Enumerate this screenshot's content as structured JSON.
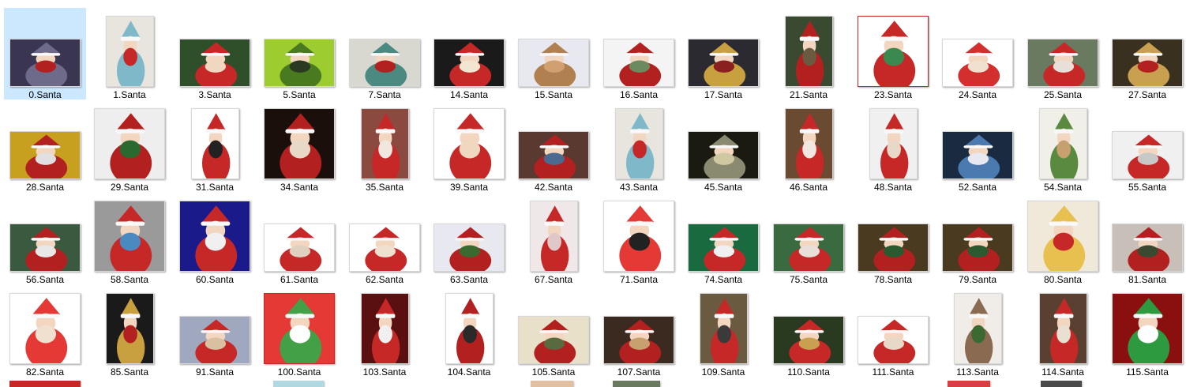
{
  "files": [
    {
      "label": "0.Santa",
      "orient": "landscape",
      "colors": [
        "#3a3550",
        "#6e6a8a",
        "#b22020"
      ],
      "selected": true
    },
    {
      "label": "1.Santa",
      "orient": "portrait",
      "colors": [
        "#e8e4de",
        "#7fb8c8",
        "#c62828"
      ]
    },
    {
      "label": "3.Santa",
      "orient": "landscape",
      "colors": [
        "#2f4f2a",
        "#c62828",
        "#f0d8c0"
      ]
    },
    {
      "label": "5.Santa",
      "orient": "landscape",
      "colors": [
        "#9ccc30",
        "#4a7a20",
        "#2a3a20"
      ]
    },
    {
      "label": "7.Santa",
      "orient": "landscape",
      "colors": [
        "#d8d8d0",
        "#4a8a80",
        "#b22020"
      ]
    },
    {
      "label": "14.Santa",
      "orient": "landscape",
      "colors": [
        "#1a1a1a",
        "#c62828",
        "#f2e6d0"
      ]
    },
    {
      "label": "15.Santa",
      "orient": "landscape",
      "colors": [
        "#e8e8f0",
        "#b08050",
        "#d0a070"
      ]
    },
    {
      "label": "16.Santa",
      "orient": "landscape",
      "colors": [
        "#f4f4f4",
        "#b22020",
        "#6a8a60"
      ]
    },
    {
      "label": "17.Santa",
      "orient": "landscape",
      "colors": [
        "#2a2a30",
        "#c8a040",
        "#8a2020"
      ]
    },
    {
      "label": "21.Santa",
      "orient": "portrait",
      "colors": [
        "#3a4a30",
        "#b22020",
        "#6a5a40"
      ]
    },
    {
      "label": "23.Santa",
      "orient": "square",
      "colors": [
        "#ffffff",
        "#c62828",
        "#3a8a50"
      ],
      "border": "#c62828"
    },
    {
      "label": "24.Santa",
      "orient": "landscape",
      "colors": [
        "#ffffff",
        "#d32f2f",
        "#f0e0d0"
      ]
    },
    {
      "label": "25.Santa",
      "orient": "landscape",
      "colors": [
        "#6a7a60",
        "#c62828",
        "#e8e0d8"
      ]
    },
    {
      "label": "27.Santa",
      "orient": "landscape",
      "colors": [
        "#3a3020",
        "#c8a050",
        "#b22020"
      ]
    },
    {
      "label": "28.Santa",
      "orient": "landscape",
      "colors": [
        "#c8a020",
        "#b22020",
        "#e0e0e0"
      ]
    },
    {
      "label": "29.Santa",
      "orient": "square",
      "colors": [
        "#eeeeee",
        "#b22020",
        "#2a6a30"
      ]
    },
    {
      "label": "31.Santa",
      "orient": "portrait",
      "colors": [
        "#ffffff",
        "#c62828",
        "#222222"
      ]
    },
    {
      "label": "34.Santa",
      "orient": "square",
      "colors": [
        "#1a0f0a",
        "#b22020",
        "#e8d8c8"
      ]
    },
    {
      "label": "35.Santa",
      "orient": "portrait",
      "colors": [
        "#8a4a40",
        "#c62828",
        "#f0e8e0"
      ]
    },
    {
      "label": "39.Santa",
      "orient": "square",
      "colors": [
        "#ffffff",
        "#c62828",
        "#f0d8c0"
      ]
    },
    {
      "label": "42.Santa",
      "orient": "landscape",
      "colors": [
        "#5a3a30",
        "#b22020",
        "#4a6a90"
      ]
    },
    {
      "label": "43.Santa",
      "orient": "portrait",
      "colors": [
        "#e8e4de",
        "#7fb8c8",
        "#c62828"
      ]
    },
    {
      "label": "45.Santa",
      "orient": "landscape",
      "colors": [
        "#1a1a10",
        "#8a8a70",
        "#d0c8a0"
      ]
    },
    {
      "label": "46.Santa",
      "orient": "portrait",
      "colors": [
        "#6a4a30",
        "#c62828",
        "#f0e8e0"
      ]
    },
    {
      "label": "48.Santa",
      "orient": "portrait",
      "colors": [
        "#f0f0f0",
        "#c62828",
        "#e8d8c8"
      ]
    },
    {
      "label": "52.Santa",
      "orient": "landscape",
      "colors": [
        "#1a2a40",
        "#4a7ab0",
        "#e8e8f0"
      ]
    },
    {
      "label": "54.Santa",
      "orient": "portrait",
      "colors": [
        "#f0f0e8",
        "#5a8a40",
        "#c8a070"
      ]
    },
    {
      "label": "55.Santa",
      "orient": "landscape",
      "colors": [
        "#f0f0f0",
        "#c62828",
        "#c8c8c8"
      ]
    },
    {
      "label": "56.Santa",
      "orient": "landscape",
      "colors": [
        "#3a5a40",
        "#b22020",
        "#e8e8e8"
      ]
    },
    {
      "label": "58.Santa",
      "orient": "square",
      "colors": [
        "#9a9a9a",
        "#c62828",
        "#4a8ac0"
      ]
    },
    {
      "label": "60.Santa",
      "orient": "square",
      "colors": [
        "#1a1a8a",
        "#c62828",
        "#f0f0f0"
      ]
    },
    {
      "label": "61.Santa",
      "orient": "landscape",
      "colors": [
        "#ffffff",
        "#c62828",
        "#e0d0c0"
      ]
    },
    {
      "label": "62.Santa",
      "orient": "landscape",
      "colors": [
        "#ffffff",
        "#c62828",
        "#f0e0d0"
      ]
    },
    {
      "label": "63.Santa",
      "orient": "landscape",
      "colors": [
        "#e8e8f0",
        "#b22020",
        "#3a6a30"
      ]
    },
    {
      "label": "67.Santa",
      "orient": "portrait",
      "colors": [
        "#f0e8e8",
        "#c62828",
        "#e0c8c8"
      ]
    },
    {
      "label": "71.Santa",
      "orient": "square",
      "colors": [
        "#ffffff",
        "#e53935",
        "#222222"
      ]
    },
    {
      "label": "74.Santa",
      "orient": "landscape",
      "colors": [
        "#1a6a40",
        "#c62828",
        "#f0f0f0"
      ]
    },
    {
      "label": "75.Santa",
      "orient": "landscape",
      "colors": [
        "#3a6a40",
        "#c62828",
        "#e8e0d8"
      ]
    },
    {
      "label": "78.Santa",
      "orient": "landscape",
      "colors": [
        "#4a3a20",
        "#b22020",
        "#2a5a30"
      ]
    },
    {
      "label": "79.Santa",
      "orient": "landscape",
      "colors": [
        "#4a3a20",
        "#b22020",
        "#2a5a30"
      ]
    },
    {
      "label": "80.Santa",
      "orient": "square",
      "colors": [
        "#f0e8d8",
        "#e8c050",
        "#c62828"
      ]
    },
    {
      "label": "81.Santa",
      "orient": "landscape",
      "colors": [
        "#c8c0b8",
        "#b22020",
        "#3a4a30"
      ]
    },
    {
      "label": "82.Santa",
      "orient": "square",
      "colors": [
        "#ffffff",
        "#e53935",
        "#f0e0d0"
      ]
    },
    {
      "label": "85.Santa",
      "orient": "portrait",
      "colors": [
        "#1a1a1a",
        "#c8a040",
        "#b22020"
      ]
    },
    {
      "label": "91.Santa",
      "orient": "landscape",
      "colors": [
        "#a0a8c0",
        "#c62828",
        "#d8c0a0"
      ]
    },
    {
      "label": "100.Santa",
      "orient": "square",
      "colors": [
        "#e53935",
        "#43a047",
        "#ffffff"
      ],
      "border": "#c62828"
    },
    {
      "label": "103.Santa",
      "orient": "portrait",
      "colors": [
        "#5a1010",
        "#c62828",
        "#f0f0f0"
      ]
    },
    {
      "label": "104.Santa",
      "orient": "portrait",
      "colors": [
        "#ffffff",
        "#b22020",
        "#2a2a2a"
      ]
    },
    {
      "label": "105.Santa",
      "orient": "landscape",
      "colors": [
        "#e8e0c8",
        "#b22020",
        "#5a6a40"
      ]
    },
    {
      "label": "107.Santa",
      "orient": "landscape",
      "colors": [
        "#3a2a20",
        "#b22020",
        "#c8a070"
      ]
    },
    {
      "label": "109.Santa",
      "orient": "portrait",
      "colors": [
        "#6a5a40",
        "#c62828",
        "#3a3a3a"
      ]
    },
    {
      "label": "110.Santa",
      "orient": "landscape",
      "colors": [
        "#2a3a20",
        "#c62828",
        "#c8a050"
      ]
    },
    {
      "label": "111.Santa",
      "orient": "landscape",
      "colors": [
        "#ffffff",
        "#c62828",
        "#e8d8c8"
      ]
    },
    {
      "label": "113.Santa",
      "orient": "portrait",
      "colors": [
        "#f0ece8",
        "#8a6a50",
        "#3a6a30"
      ]
    },
    {
      "label": "114.Santa",
      "orient": "portrait",
      "colors": [
        "#5a4030",
        "#c62828",
        "#e8e0d0"
      ]
    },
    {
      "label": "115.Santa",
      "orient": "square",
      "colors": [
        "#8a1010",
        "#2e9a40",
        "#ffffff"
      ]
    }
  ]
}
